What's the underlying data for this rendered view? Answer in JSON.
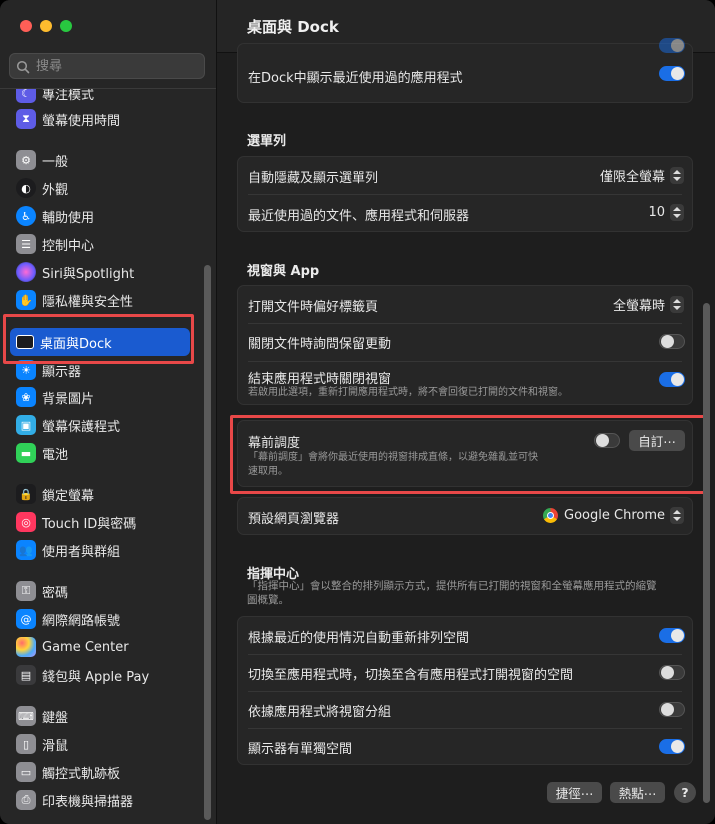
{
  "window": {
    "title": "桌面與 Dock"
  },
  "search": {
    "placeholder": "搜尋"
  },
  "sidebar": {
    "items": [
      {
        "label": "專注模式",
        "icon": "moon-icon",
        "color": "#5e5ce6"
      },
      {
        "label": "螢幕使用時間",
        "icon": "hourglass-icon",
        "color": "#5e5ce6"
      },
      {
        "label": "一般",
        "icon": "gear-icon",
        "color": "#8e8e93"
      },
      {
        "label": "外觀",
        "icon": "appearance-icon",
        "color": "#1c1c1e"
      },
      {
        "label": "輔助使用",
        "icon": "accessibility-icon",
        "color": "#0a84ff"
      },
      {
        "label": "控制中心",
        "icon": "toggles-icon",
        "color": "#8e8e93"
      },
      {
        "label": "Siri與Spotlight",
        "icon": "siri-icon",
        "color": "#c2409c"
      },
      {
        "label": "隱私權與安全性",
        "icon": "hand-icon",
        "color": "#0a84ff"
      },
      {
        "label": "桌面與Dock",
        "icon": "dock-icon",
        "color": "#1c1c1e"
      },
      {
        "label": "顯示器",
        "icon": "sun-icon",
        "color": "#0a84ff"
      },
      {
        "label": "背景圖片",
        "icon": "flower-icon",
        "color": "#0a84ff"
      },
      {
        "label": "螢幕保護程式",
        "icon": "screensaver-icon",
        "color": "#32ade6"
      },
      {
        "label": "電池",
        "icon": "battery-icon",
        "color": "#30d158"
      },
      {
        "label": "鎖定螢幕",
        "icon": "lock-icon",
        "color": "#1c1c1e"
      },
      {
        "label": "Touch ID與密碼",
        "icon": "fingerprint-icon",
        "color": "#ff375f"
      },
      {
        "label": "使用者與群組",
        "icon": "users-icon",
        "color": "#0a84ff"
      },
      {
        "label": "密碼",
        "icon": "key-icon",
        "color": "#8e8e93"
      },
      {
        "label": "網際網路帳號",
        "icon": "at-icon",
        "color": "#0a84ff"
      },
      {
        "label": "Game Center",
        "icon": "game-center-icon",
        "color": "#3a3a3c"
      },
      {
        "label": "錢包與 Apple Pay",
        "icon": "wallet-icon",
        "color": "#1c1c1e"
      },
      {
        "label": "鍵盤",
        "icon": "keyboard-icon",
        "color": "#8e8e93"
      },
      {
        "label": "滑鼠",
        "icon": "mouse-icon",
        "color": "#8e8e93"
      },
      {
        "label": "觸控式軌跡板",
        "icon": "trackpad-icon",
        "color": "#8e8e93"
      },
      {
        "label": "印表機與掃描器",
        "icon": "printer-icon",
        "color": "#8e8e93"
      }
    ]
  },
  "main": {
    "dock_recent": {
      "label": "在Dock中顯示最近使用過的應用程式",
      "on": true
    },
    "menubar": {
      "heading": "選單列",
      "autohide_label": "自動隱藏及顯示選單列",
      "autohide_value": "僅限全螢幕",
      "recent_label": "最近使用過的文件、應用程式和伺服器",
      "recent_value": "10"
    },
    "windows": {
      "heading": "視窗與 App",
      "tabs_label": "打開文件時偏好標籤頁",
      "tabs_value": "全螢幕時",
      "ask_label": "關閉文件時詢問保留更動",
      "ask_on": false,
      "close_label": "結束應用程式時關閉視窗",
      "close_on": true,
      "close_desc": "若啟用此選項，重新打開應用程式時，將不會回復已打開的文件和視窗。"
    },
    "stage_manager": {
      "label": "幕前調度",
      "desc_line1": "「幕前調度」會將你最近使用的視窗排成直條，以避免雜亂並可快",
      "desc_line2": "速取用。",
      "on": false,
      "customize": "自訂⋯"
    },
    "browser": {
      "label": "預設網頁瀏覽器",
      "value": "Google Chrome"
    },
    "mission_control": {
      "heading": "指揮中心",
      "desc_line1": "「指揮中心」會以整合的排列顯示方式，提供所有已打開的視窗和全螢幕應用程式的縮覽",
      "desc_line2": "圖概覽。",
      "rows": [
        {
          "label": "根據最近的使用情況自動重新排列空間",
          "on": true
        },
        {
          "label": "切換至應用程式時，切換至含有應用程式打開視窗的空間",
          "on": false
        },
        {
          "label": "依據應用程式將視窗分組",
          "on": false
        },
        {
          "label": "顯示器有單獨空間",
          "on": true
        }
      ]
    },
    "footer": {
      "shortcuts": "捷徑⋯",
      "hot_corners": "熱點⋯",
      "help": "?"
    }
  },
  "colors": {
    "accent": "#1a6ee6",
    "selection": "#1a5bd0",
    "highlight": "#e84848"
  }
}
